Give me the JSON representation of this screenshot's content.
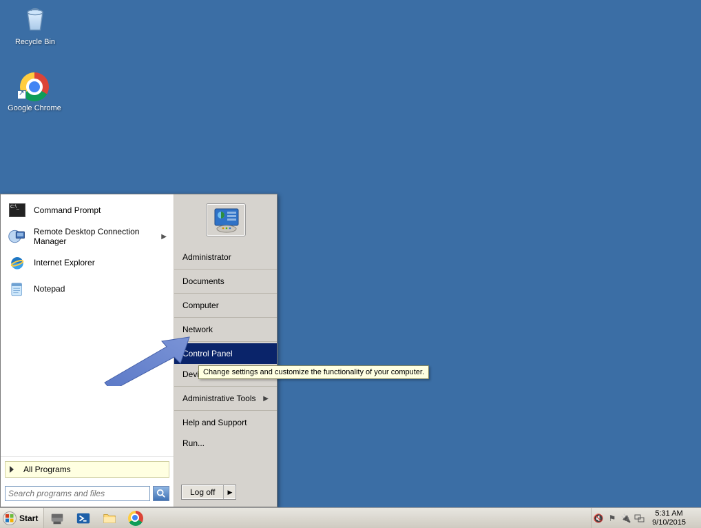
{
  "desktop": {
    "icons": [
      {
        "name": "recycle-bin",
        "label": "Recycle Bin"
      },
      {
        "name": "google-chrome",
        "label": "Google Chrome"
      }
    ]
  },
  "start_menu": {
    "pinned": [
      {
        "name": "command-prompt",
        "label": "Command Prompt",
        "has_submenu": false
      },
      {
        "name": "rdc-manager",
        "label": "Remote Desktop Connection Manager",
        "has_submenu": true
      },
      {
        "name": "internet-explorer",
        "label": "Internet Explorer",
        "has_submenu": false
      },
      {
        "name": "notepad",
        "label": "Notepad",
        "has_submenu": false
      }
    ],
    "all_programs_label": "All Programs",
    "search_placeholder": "Search programs and files",
    "right": {
      "user_label": "Administrator",
      "groups": [
        [
          "Administrator"
        ],
        [
          "Documents"
        ],
        [
          "Computer"
        ],
        [
          "Network"
        ],
        [
          "Control Panel",
          "Devices and Printers"
        ],
        [
          "Administrative Tools"
        ],
        [
          "Help and Support",
          "Run..."
        ]
      ],
      "selected": "Control Panel",
      "devices_visible_prefix": "Devi",
      "admin_tools_has_submenu": true
    },
    "logoff_label": "Log off",
    "tooltip_text": "Change settings and customize the functionality of your computer."
  },
  "taskbar": {
    "start_label": "Start",
    "quicklaunch": [
      "server-manager",
      "powershell",
      "explorer",
      "chrome"
    ],
    "tray_icons": [
      "volume-muted-icon",
      "flag-icon",
      "power-icon",
      "network-icon"
    ],
    "clock_time": "5:31 AM",
    "clock_date": "9/10/2015"
  }
}
